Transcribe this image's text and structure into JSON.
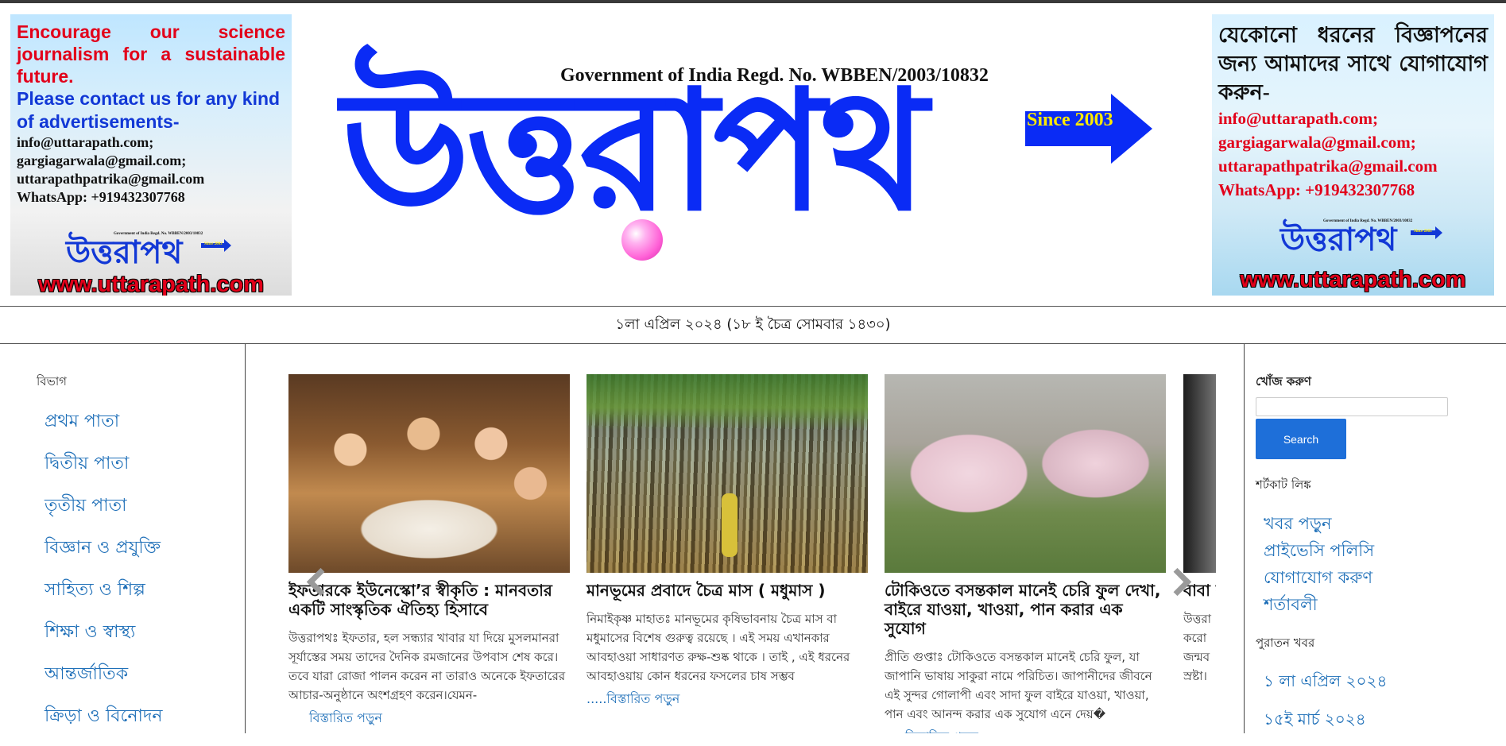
{
  "ads": {
    "left": {
      "headline_red": "Encourage our science journalism for a sustainable future.",
      "headline_blue": "Please contact us for any kind of advertisements-",
      "emails": [
        "info@uttarapath.com;",
        "gargiagarwala@gmail.com;",
        "uttarapathpatrika@gmail.com"
      ],
      "whatsapp": "WhatsApp: +919432307768",
      "mini_logo": "উত্তরাপথ",
      "mini_regd": "Government of India Regd. No. WBBEN/2003/10832",
      "mini_since": "Since 2003",
      "site": "www.uttarapath.com"
    },
    "right": {
      "headline_bn": "যেকোনো ধরনের বিজ্ঞাপনের জন্য আমাদের সাথে যোগাযোগ করুন-",
      "emails": [
        "info@uttarapath.com;",
        "gargiagarwala@gmail.com;",
        "uttarapathpatrika@gmail.com"
      ],
      "whatsapp": "WhatsApp: +919432307768",
      "mini_logo": "উত্তরাপথ",
      "mini_regd": "Government of India Regd. No. WBBEN/2003/10832",
      "mini_since": "Since 2003",
      "site": "www.uttarapath.com"
    }
  },
  "masthead": {
    "regd": "Government of India Regd. No. WBBEN/2003/10832",
    "logo": "উত্তরাপথ",
    "since": "Since 2003"
  },
  "date_line": "১লা এপ্রিল ২০২৪ (১৮ ই চৈত্র সোমবার ১৪৩০)",
  "left_sidebar": {
    "heading": "বিভাগ",
    "items": [
      "প্রথম পাতা",
      "দ্বিতীয় পাতা",
      "তৃতীয় পাতা",
      "বিজ্ঞান ও প্রযুক্তি",
      "সাহিত্য ও শিল্প",
      "শিক্ষা ও স্বাস্থ্য",
      "আন্তর্জাতিক",
      "ক্রিড়া ও বিনোদন"
    ]
  },
  "slider": {
    "cards": [
      {
        "image": "iftar-family-dinner",
        "title": "ইফতারকে ইউনেস্কো’র স্বীকৃতি : মানবতার একটি সাংস্কৃতিক ঐতিহ্য হিসাবে",
        "excerpt": "উত্তরাপথঃ ইফতার, হল সন্ধ্যার খাবার যা দিয়ে মুসলমানরা সূর্যাস্তের সময় তাদের দৈনিক রমজানের উপবাস শেষ করে। তবে যারা রোজা পালন করেন না তারাও অনেকে ইফতারের আচার-অনুষ্ঠানে অংশগ্রহণ করেন।যেমন-",
        "more": "বিস্তারিত পড়ুন"
      },
      {
        "image": "sugarcane-field",
        "title": "মানভূমের প্রবাদে চৈত্র মাস ( মধুমাস )",
        "excerpt": "নিমাইকৃষ্ণ মাহাতঃ মানভূমের কৃষিভাবনায় চৈত্র মাস বা মধুমাসের বিশেষ গুরুত্ব রয়েছে । এই সময় এখানকার আবহাওয়া সাধারণত রুক্ষ-শুষ্ক থাকে । তাই , এই ধরনের আবহাওয়ায় কোন ধরনের ফসলের চাষ সম্ভব",
        "more": ".....বিস্তারিত পড়ুন"
      },
      {
        "image": "cherry-blossom-park",
        "title": "টোকিওতে বসন্তকাল মানেই চেরি ফুল দেখা, বাইরে যাওয়া, খাওয়া, পান করার এক সুযোগ",
        "excerpt": "প্রীতি গুপ্তাঃ টোকিওতে বসন্তকাল মানেই চেরি ফুল, যা জাপানি ভাষায় সাকুরা নামে পরিচিত। জাপানীদের জীবনে এই সুন্দর গোলাপী এবং সাদা ফুল বাইরে যাওয়া, খাওয়া, পান এবং আনন্দ করার এক সুযোগ এনে দেয়�",
        "more": "বিস্তারিত পড়ুন"
      },
      {
        "image": "portrait-dark",
        "title": "বাবা সংগি কেন",
        "excerpt": "উত্তরা করো জন্মব স্রষ্টা।",
        "more": ""
      }
    ]
  },
  "right_sidebar": {
    "search_heading": "খোঁজ করুণ",
    "search_placeholder": "",
    "search_button": "Search",
    "shortcut_heading": "শর্টকাট লিঙ্ক",
    "shortcuts": [
      "খবর পড়ুন",
      "প্রাইভেসি পলিসি",
      "যোগাযোগ করুণ",
      "শর্তাবলী"
    ],
    "archive_heading": "পুরাতন খবর",
    "archive": [
      "১ লা এপ্রিল ২০২৪",
      "১৫ই মার্চ ২০২৪"
    ]
  },
  "colors": {
    "logo_blue": "#0a2bf5",
    "link_blue": "#1e6fb8",
    "button_blue": "#1e6fd9",
    "ad_red": "#e2001a"
  }
}
